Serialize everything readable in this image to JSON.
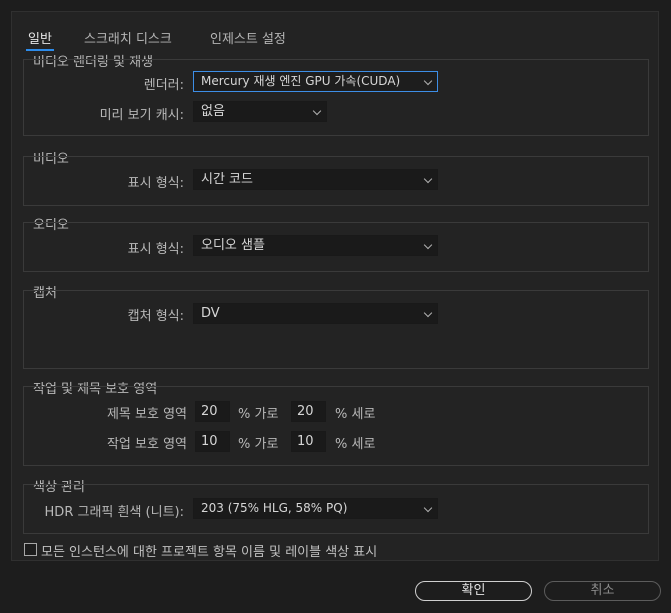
{
  "tabs": [
    "일반",
    "스크래치 디스크",
    "인제스트 설정"
  ],
  "video_rendering": {
    "title": "비디오 렌더링 및 재생",
    "renderer_label": "렌더러:",
    "renderer_value": "Mercury 재생 엔진 GPU 가속(CUDA)",
    "preview_cache_label": "미리 보기 캐시:",
    "preview_cache_value": "없음"
  },
  "video": {
    "title": "비디오",
    "display_format_label": "표시 형식:",
    "display_format_value": "시간 코드"
  },
  "audio": {
    "title": "오디오",
    "display_format_label": "표시 형식:",
    "display_format_value": "오디오 샘플"
  },
  "capture": {
    "title": "캡처",
    "format_label": "캡처 형식:",
    "format_value": "DV"
  },
  "safe_margins": {
    "title": "작업 및 제목 보호 영역",
    "title_safe_label": "제목 보호 영역",
    "title_h": "20",
    "title_v": "20",
    "action_safe_label": "작업 보호 영역",
    "action_h": "10",
    "action_v": "10",
    "horizontal_unit": "% 가로",
    "vertical_unit": "% 세로"
  },
  "color_management": {
    "title": "색상 관리",
    "hdr_white_label": "HDR 그래픽 흰색 (니트):",
    "hdr_white_value": "203 (75% HLG, 58% PQ)"
  },
  "show_label_colors": {
    "label": "모든 인스턴스에 대한 프로젝트 항목 이름 및 레이블 색상 표시",
    "checked": false
  },
  "buttons": {
    "ok": "확인",
    "cancel": "취소"
  }
}
